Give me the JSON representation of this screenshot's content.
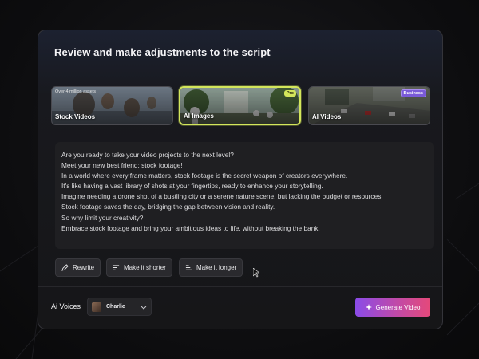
{
  "panel": {
    "title": "Review and make adjustments to the script"
  },
  "media_types": [
    {
      "label": "Stock Videos",
      "sub": "Over 4 million assets",
      "badge": ""
    },
    {
      "label": "AI Images",
      "sub": "",
      "badge": "Pro"
    },
    {
      "label": "AI Videos",
      "sub": "",
      "badge": "Business"
    }
  ],
  "script_lines": [
    "Are you ready to take your video projects to the next level?",
    "Meet your new best friend: stock footage!",
    "In a world where every frame matters, stock footage is the secret weapon of creators everywhere.",
    "It's like having a vast library of shots at your fingertips, ready to enhance your storytelling.",
    "Imagine needing a drone shot of a bustling city or a serene nature scene, but lacking the budget or resources.",
    "Stock footage saves the day, bridging the gap between vision and reality.",
    "So why limit your creativity?",
    "Embrace stock footage and bring your ambitious ideas to life, without breaking the bank."
  ],
  "actions": {
    "rewrite": "Rewrite",
    "shorter": "Make it shorter",
    "longer": "Make it longer"
  },
  "voices": {
    "label": "Ai Voices",
    "selected": "Charlie"
  },
  "generate": {
    "label": "Generate Video"
  },
  "colors": {
    "accent_selected": "#d3e65b",
    "business_badge": "#7a5ad8",
    "generate_gradient_start": "#8a4be8",
    "generate_gradient_end": "#e5497a"
  }
}
